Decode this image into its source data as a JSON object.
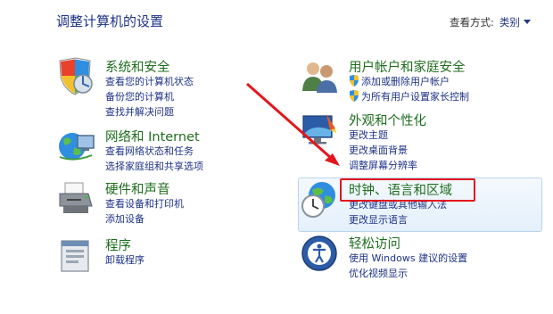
{
  "header": {
    "title": "调整计算机的设置",
    "view_by_label": "查看方式:",
    "view_by_value": "类别"
  },
  "categories": [
    {
      "title": "系统和安全",
      "links": [
        "查看您的计算机状态",
        "备份您的计算机",
        "查找并解决问题"
      ]
    },
    {
      "title": "网络和 Internet",
      "links": [
        "查看网络状态和任务",
        "选择家庭组和共享选项"
      ]
    },
    {
      "title": "硬件和声音",
      "links": [
        "查看设备和打印机",
        "添加设备"
      ]
    },
    {
      "title": "程序",
      "links": [
        "卸载程序"
      ]
    },
    {
      "title": "用户帐户和家庭安全",
      "links": [
        "添加或删除用户帐户",
        "为所有用户设置家长控制"
      ]
    },
    {
      "title": "外观和个性化",
      "links": [
        "更改主题",
        "更改桌面背景",
        "调整屏幕分辨率"
      ]
    },
    {
      "title": "时钟、语言和区域",
      "links": [
        "更改键盘或其他输入法",
        "更改显示语言"
      ]
    },
    {
      "title": "轻松访问",
      "links": [
        "使用 Windows 建议的设置",
        "优化视频显示"
      ]
    }
  ],
  "icons": [
    "security-shield-icon",
    "network-globe-icon",
    "printer-icon",
    "programs-icon",
    "users-icon",
    "appearance-icon",
    "clock-globe-icon",
    "accessibility-icon"
  ],
  "colors": {
    "title_green": "#1e6d1e",
    "link_blue": "#1e3287",
    "annotation_red": "#e3161c"
  }
}
